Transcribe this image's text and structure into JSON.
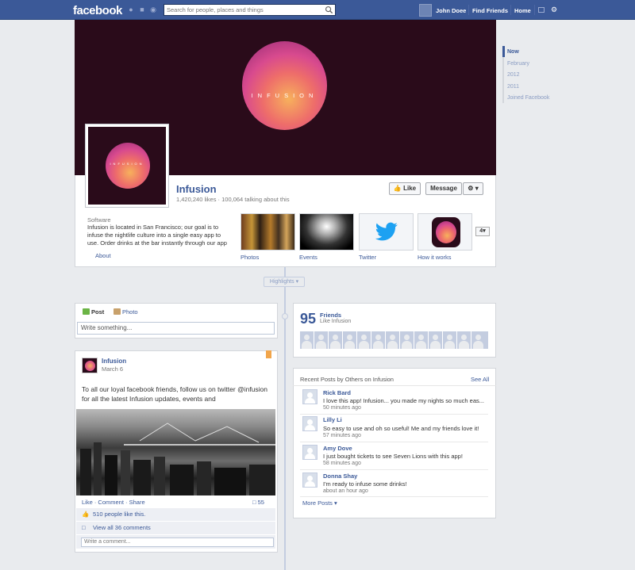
{
  "topbar": {
    "logo": "facebook",
    "search_placeholder": "Search for people, places and things",
    "user_name": "John Doee",
    "find_friends": "Find Friends",
    "home": "Home"
  },
  "page": {
    "cover_word": "INFUSION",
    "name": "Infusion",
    "stats": "1,420,240 likes · 100,064 talking about this",
    "like_label": "Like",
    "message_label": "Message",
    "category": "Software",
    "about_text": "Infusion is located in San Francisco; our goal is to infuse the nightlife culture into a single easy app to use. Order drinks at the bar instantly through our app",
    "about_link": "About",
    "apps": [
      {
        "label": "Photos"
      },
      {
        "label": "Events"
      },
      {
        "label": "Twitter"
      },
      {
        "label": "How it works"
      }
    ],
    "more_apps": "4"
  },
  "timeline_nav": [
    "Now",
    "February",
    "2012",
    "2011",
    "Joined Facebook"
  ],
  "highlights_label": "Highlights",
  "composer": {
    "tab_post": "Post",
    "tab_photo": "Photo",
    "placeholder": "Write something..."
  },
  "post": {
    "author": "Infusion",
    "date": "March 6",
    "text": "To all our loyal facebook friends, follow us on twitter @infusion for all the latest Infusion updates, events and",
    "actions": "Like · Comment · Share",
    "comment_count": "55",
    "likes_text": "510 people like this.",
    "view_comments": "View all 36 comments",
    "comment_placeholder": "Write a comment..."
  },
  "friends": {
    "count": "95",
    "label": "Friends",
    "sub": "Like Infusion"
  },
  "recent": {
    "title": "Recent Posts by Others on Infusion",
    "see_all": "See All",
    "items": [
      {
        "name": "Rick Bard",
        "text": "I love this app! Infusion... you made my nights so much eas...",
        "time": "50 minutes ago"
      },
      {
        "name": "Lilly Li",
        "text": "So easy to use and oh so useful! Me and my friends love it!",
        "time": "57 minutes ago"
      },
      {
        "name": "Amy Dove",
        "text": "I just bought tickets to see Seven Lions with this app!",
        "time": "58 minutes ago"
      },
      {
        "name": "Donna Shay",
        "text": "I'm ready to infuse some drinks!",
        "time": "about an hour ago"
      }
    ],
    "more_posts": "More Posts"
  },
  "colors": {
    "brand": "#3b5998",
    "cover_bg": "#2a0b1a",
    "bookmark": "#f1a54b",
    "twitter": "#1da1f2"
  }
}
